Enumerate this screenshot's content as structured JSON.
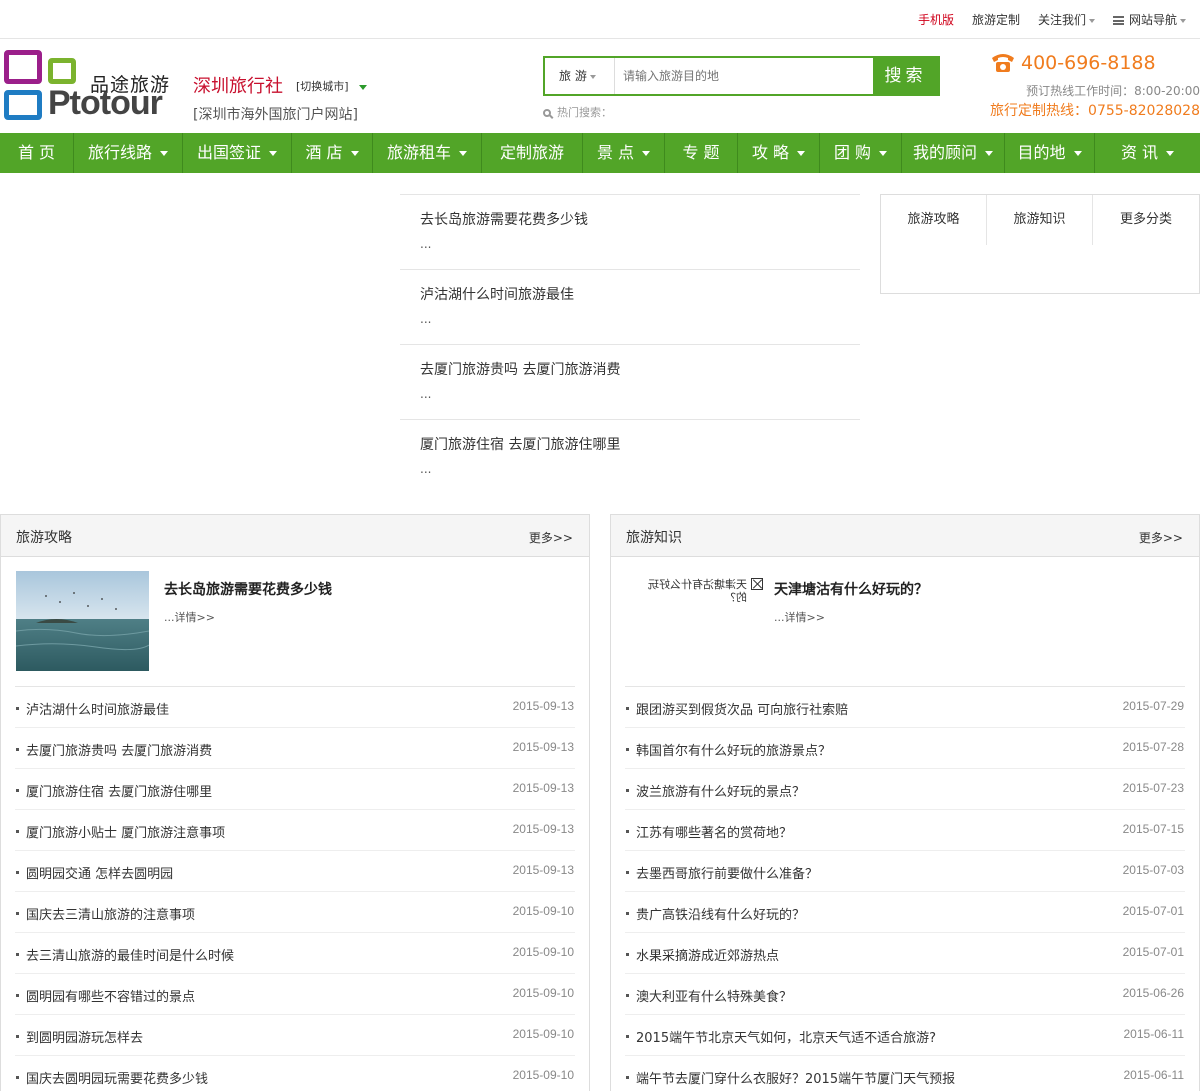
{
  "topbar": {
    "mobile": "手机版",
    "custom_travel": "旅游定制",
    "follow_us": "关注我们",
    "site_nav": "网站导航"
  },
  "header": {
    "brand_cn": "品途旅游",
    "brand_en": "Ptotour",
    "agency": "深圳旅行社",
    "switch_city": "[切换城市]",
    "slogan": "[深圳市海外国旅门户网站]",
    "search_category": "旅  游",
    "search_placeholder": "请输入旅游目的地",
    "search_button": "搜索",
    "hot_search": "热门搜索：",
    "hotline": "400-696-8188",
    "work_time": "预订热线工作时间：8:00-20:00",
    "custom_hotline": "旅行定制热线：0755-82028028",
    "colors": {
      "brand_green": "#52a528",
      "hotline_orange": "#f07c1e",
      "agency_red": "#c8102e"
    }
  },
  "nav": {
    "items": [
      {
        "label": "首 页"
      },
      {
        "label": "旅行线路"
      },
      {
        "label": "出国签证"
      },
      {
        "label": "酒 店"
      },
      {
        "label": "旅游租车"
      },
      {
        "label": "定制旅游"
      },
      {
        "label": "景 点"
      },
      {
        "label": "专 题"
      },
      {
        "label": "攻 略"
      },
      {
        "label": "团 购"
      },
      {
        "label": "我的顾问"
      },
      {
        "label": "目的地"
      },
      {
        "label": "资 讯"
      }
    ]
  },
  "articles": [
    {
      "title": "去长岛旅游需要花费多少钱",
      "desc": "..."
    },
    {
      "title": "泸沽湖什么时间旅游最佳",
      "desc": "..."
    },
    {
      "title": "去厦门旅游贵吗 去厦门旅游消费",
      "desc": "..."
    },
    {
      "title": "厦门旅游住宿 去厦门旅游住哪里",
      "desc": "..."
    }
  ],
  "categories": {
    "tabs": [
      "旅游攻略",
      "旅游知识",
      "更多分类"
    ]
  },
  "guide_panel": {
    "title": "旅游攻略",
    "more": "更多>>",
    "feature_title": "去长岛旅游需要花费多少钱",
    "feature_desc": "...详情>>",
    "rows": [
      {
        "title": "泸沽湖什么时间旅游最佳",
        "date": "2015-09-13"
      },
      {
        "title": "去厦门旅游贵吗 去厦门旅游消费",
        "date": "2015-09-13"
      },
      {
        "title": "厦门旅游住宿 去厦门旅游住哪里",
        "date": "2015-09-13"
      },
      {
        "title": "厦门旅游小贴士 厦门旅游注意事项",
        "date": "2015-09-13"
      },
      {
        "title": "圆明园交通 怎样去圆明园",
        "date": "2015-09-13"
      },
      {
        "title": "国庆去三清山旅游的注意事项",
        "date": "2015-09-10"
      },
      {
        "title": "去三清山旅游的最佳时间是什么时候",
        "date": "2015-09-10"
      },
      {
        "title": "圆明园有哪些不容错过的景点",
        "date": "2015-09-10"
      },
      {
        "title": "到圆明园游玩怎样去",
        "date": "2015-09-10"
      },
      {
        "title": "国庆去圆明园玩需要花费多少钱",
        "date": "2015-09-10"
      }
    ]
  },
  "knowledge_panel": {
    "title": "旅游知识",
    "more": "更多>>",
    "feature_title": "天津塘沽有什么好玩的？",
    "feature_img_alt": "天津塘沽有什么好玩的？",
    "feature_desc": "...详情>>",
    "rows": [
      {
        "title": "跟团游买到假货次品 可向旅行社索赔",
        "date": "2015-07-29"
      },
      {
        "title": "韩国首尔有什么好玩的旅游景点？",
        "date": "2015-07-28"
      },
      {
        "title": "波兰旅游有什么好玩的景点？",
        "date": "2015-07-23"
      },
      {
        "title": "江苏有哪些著名的赏荷地？",
        "date": "2015-07-15"
      },
      {
        "title": "去墨西哥旅行前要做什么准备？",
        "date": "2015-07-03"
      },
      {
        "title": "贵广高铁沿线有什么好玩的？",
        "date": "2015-07-01"
      },
      {
        "title": "水果采摘游成近郊游热点",
        "date": "2015-07-01"
      },
      {
        "title": "澳大利亚有什么特殊美食？",
        "date": "2015-06-26"
      },
      {
        "title": "2015端午节北京天气如何，北京天气适不适合旅游?",
        "date": "2015-06-11"
      },
      {
        "title": "端午节去厦门穿什么衣服好？2015端午节厦门天气预报",
        "date": "2015-06-11"
      }
    ]
  }
}
